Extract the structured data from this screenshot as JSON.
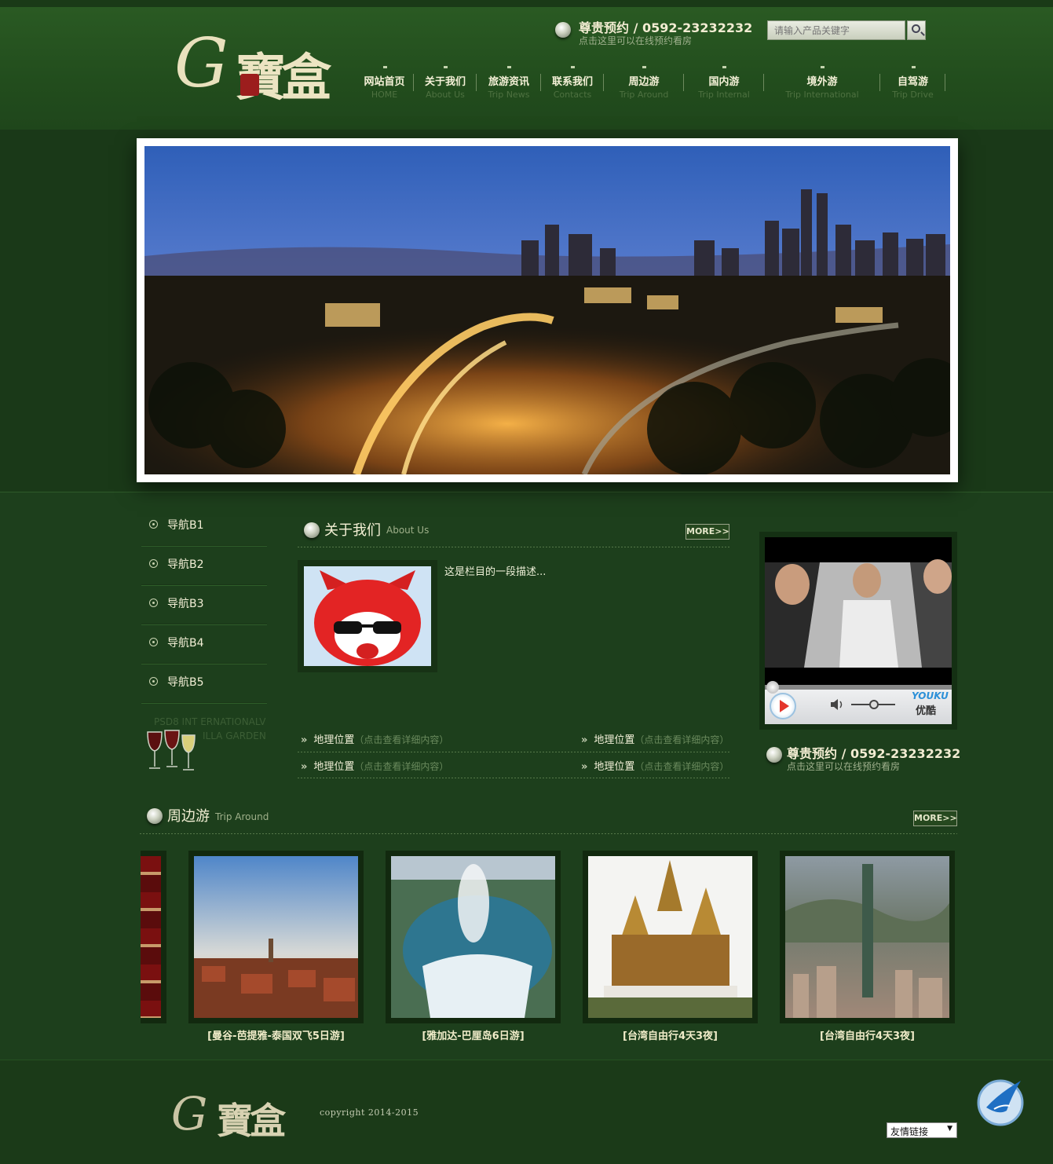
{
  "header": {
    "phone": "尊贵预约 / 0592-23232232",
    "phone_sub": "点击这里可以在线预约看房",
    "search_placeholder": "请输入产品关键字",
    "nav": [
      {
        "cn": "网站首页",
        "en": "HOME"
      },
      {
        "cn": "关于我们",
        "en": "About Us"
      },
      {
        "cn": "旅游资讯",
        "en": "Trip News"
      },
      {
        "cn": "联系我们",
        "en": "Contacts"
      },
      {
        "cn": "周边游",
        "en": "Trip Around"
      },
      {
        "cn": "国内游",
        "en": "Trip Internal"
      },
      {
        "cn": "境外游",
        "en": "Trip International"
      },
      {
        "cn": "自驾游",
        "en": "Trip Drive"
      }
    ]
  },
  "sidebar": {
    "items": [
      "导航B1",
      "导航B2",
      "导航B3",
      "导航B4",
      "导航B5"
    ],
    "wine_line1": "PSD8 INT ERNATIONALV",
    "wine_line2": "ILLA GARDEN"
  },
  "about": {
    "title_cn": "关于我们",
    "title_en": "About Us",
    "more": "MORE>>",
    "desc": "这是栏目的一段描述...",
    "links": [
      {
        "label": "地理位置",
        "sub": "（点击查看详细内容）"
      },
      {
        "label": "地理位置",
        "sub": "（点击查看详细内容）"
      },
      {
        "label": "地理位置",
        "sub": "（点击查看详细内容）"
      },
      {
        "label": "地理位置",
        "sub": "（点击查看详细内容）"
      }
    ]
  },
  "video": {
    "brand_en": "YOUKU",
    "brand_cn": "优酷"
  },
  "side_contact": {
    "phone": "尊贵预约 / 0592-23232232",
    "sub": "点击这里可以在线预约看房"
  },
  "trip": {
    "title_cn": "周边游",
    "title_en": "Trip Around",
    "more": "MORE>>",
    "items": [
      "[曼谷-芭提雅-泰国双飞5日游]",
      "[雅加达-巴厘岛6日游]",
      "[台湾自由行4天3夜]",
      "[台湾自由行4天3夜]"
    ]
  },
  "footer": {
    "copyright": "copyright 2014-2015",
    "friend_links": "友情链接"
  },
  "brand": {
    "logo_text": "寶盒",
    "logo_letter": "G"
  }
}
